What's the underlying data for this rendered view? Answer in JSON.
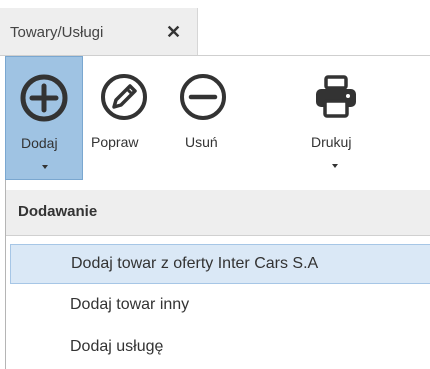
{
  "tab": {
    "label": "Towary/Usługi",
    "close_glyph": "✕"
  },
  "ribbon": {
    "buttons": [
      {
        "label": "Dodaj",
        "icon": "plus-circle-icon",
        "active": true,
        "has_dropdown": true
      },
      {
        "label": "Popraw",
        "icon": "pencil-circle-icon",
        "active": false,
        "has_dropdown": false
      },
      {
        "label": "Usuń",
        "icon": "minus-circle-icon",
        "active": false,
        "has_dropdown": false
      },
      {
        "label": "Drukuj",
        "icon": "printer-icon",
        "active": false,
        "has_dropdown": true
      }
    ]
  },
  "dropdown": {
    "header": "Dodawanie",
    "items": [
      {
        "label": "Dodaj towar z oferty Inter Cars S.A",
        "highlighted": true
      },
      {
        "label": "Dodaj towar inny",
        "highlighted": false
      },
      {
        "label": "Dodaj usługę",
        "highlighted": false
      }
    ]
  },
  "colors": {
    "active_button_bg": "#9fc3e3",
    "highlight_item_bg": "#dae8f6",
    "icon_stroke": "#333333"
  }
}
